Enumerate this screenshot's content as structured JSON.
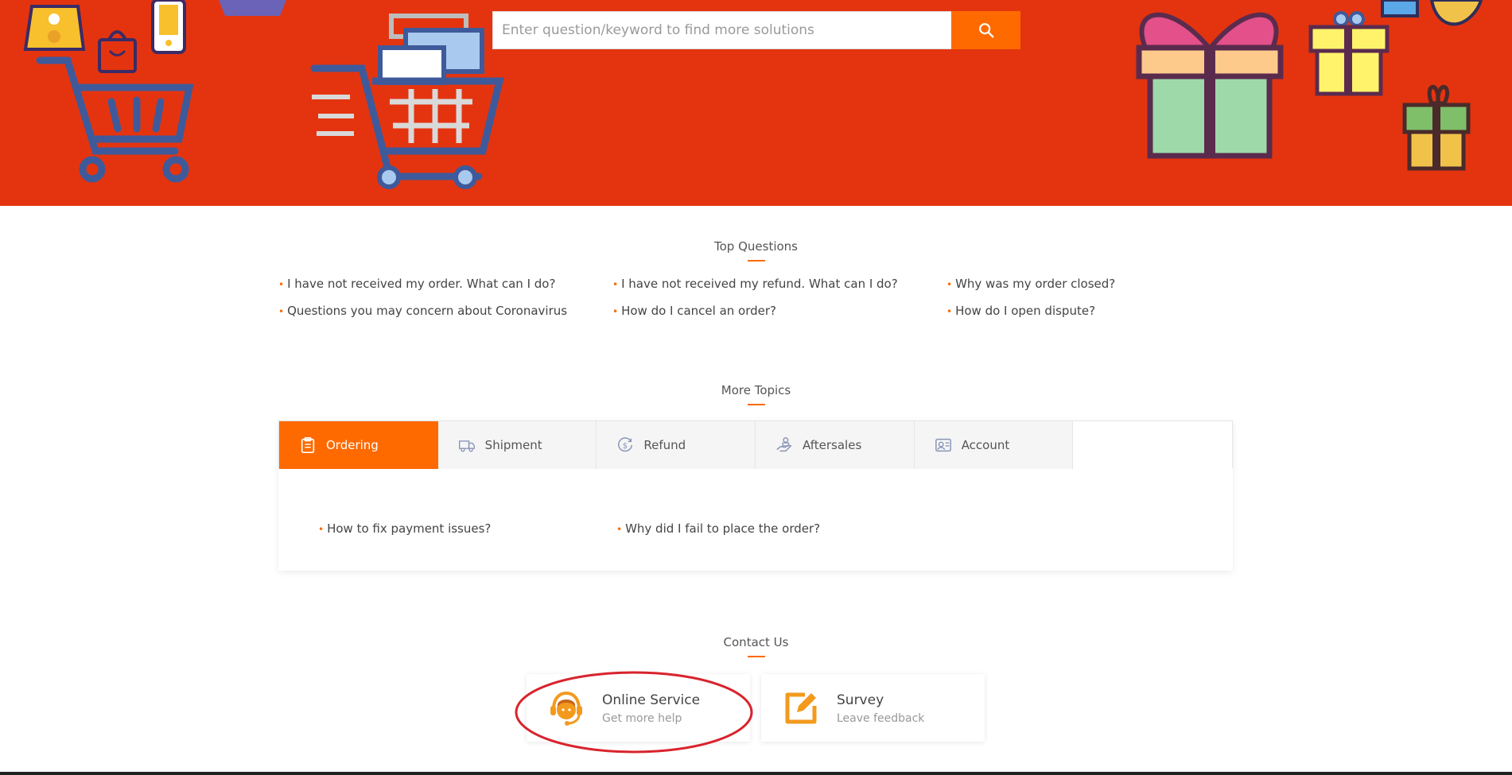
{
  "search": {
    "placeholder": "Enter question/keyword to find more solutions",
    "button_icon": "search-icon"
  },
  "top_questions": {
    "title": "Top Questions",
    "items": [
      "I have not received my order. What can I do?",
      "I have not received my refund. What can I do?",
      "Why was my order closed?",
      "Questions you may concern about Coronavirus",
      "How do I cancel an order?",
      "How do I open dispute?"
    ]
  },
  "more_topics": {
    "title": "More Topics",
    "tabs": [
      {
        "label": "Ordering",
        "icon": "clipboard-icon",
        "active": true
      },
      {
        "label": "Shipment",
        "icon": "truck-icon",
        "active": false
      },
      {
        "label": "Refund",
        "icon": "dollar-refund-icon",
        "active": false
      },
      {
        "label": "Aftersales",
        "icon": "hand-service-icon",
        "active": false
      },
      {
        "label": "Account",
        "icon": "account-card-icon",
        "active": false
      }
    ],
    "links": [
      "How to fix payment issues?",
      "Why did I fail to place the order?"
    ]
  },
  "contact": {
    "title": "Contact Us",
    "cards": [
      {
        "title": "Online Service",
        "subtitle": "Get more help",
        "icon": "headset-agent-icon"
      },
      {
        "title": "Survey",
        "subtitle": "Leave feedback",
        "icon": "edit-survey-icon"
      }
    ]
  },
  "colors": {
    "banner": "#e4340f",
    "accent": "#ff6a00",
    "highlight_ring": "#d9232d"
  }
}
